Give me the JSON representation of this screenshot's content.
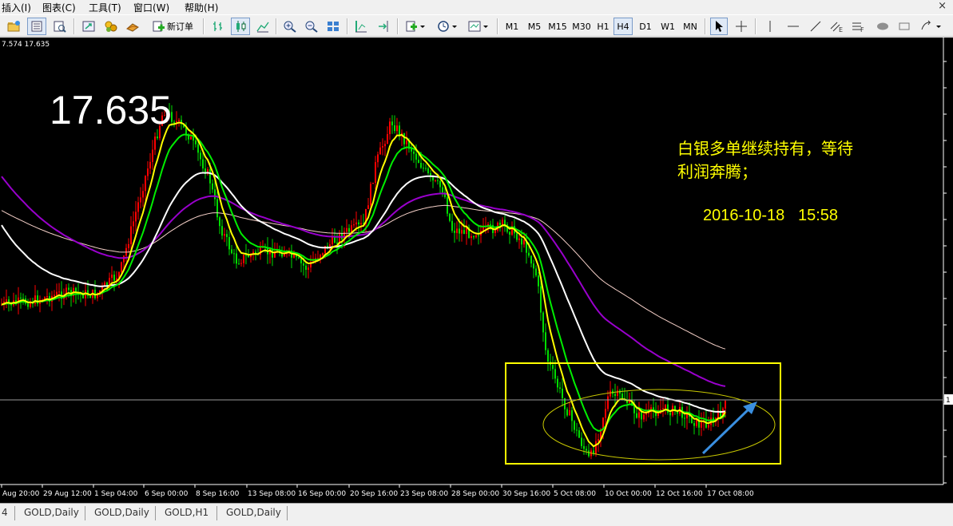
{
  "menu": {
    "items": [
      "插入(I)",
      "图表(C)",
      "工具(T)",
      "窗口(W)",
      "帮助(H)"
    ],
    "close_glyph": "×"
  },
  "toolbar": {
    "new_order_label": "新订单",
    "timeframes": [
      "M1",
      "M5",
      "M15",
      "M30",
      "H1",
      "H4",
      "D1",
      "W1",
      "MN"
    ],
    "active_timeframe": "H4"
  },
  "chart": {
    "info_text": "7.574 17.635",
    "big_price": "17.635",
    "note_line1": "白银多单继续持有，等待",
    "note_line2": "利润奔腾；",
    "stamp": "2016-10-18   15:58",
    "time_axis_labels": [
      "Aug 20:00",
      "29 Aug 12:00",
      "1 Sep 04:00",
      "6 Sep 00:00",
      "8 Sep 16:00",
      "13 Sep 08:00",
      "16 Sep 00:00",
      "20 Sep 16:00",
      "23 Sep 08:00",
      "28 Sep 00:00",
      "30 Sep 16:00",
      "5 Oct 08:00",
      "10 Oct 00:00",
      "12 Oct 16:00",
      "17 Oct 08:00"
    ],
    "price_axis_label": "1",
    "colors": {
      "background": "#000000",
      "bull_candle": "#ff0000",
      "bear_candle": "#00dd00",
      "ma_fast": "#ffff00",
      "ma_mid": "#00ee00",
      "ma_slow": "#ffffff",
      "ma_long": "#9900cc",
      "ma_longest": "#f5d0c8",
      "annotation": "#ffff00",
      "arrow": "#3a8fe0"
    }
  },
  "bottom_tabs": [
    "4",
    "GOLD,Daily",
    "GOLD,Daily",
    "GOLD,H1",
    "GOLD,Daily"
  ]
}
